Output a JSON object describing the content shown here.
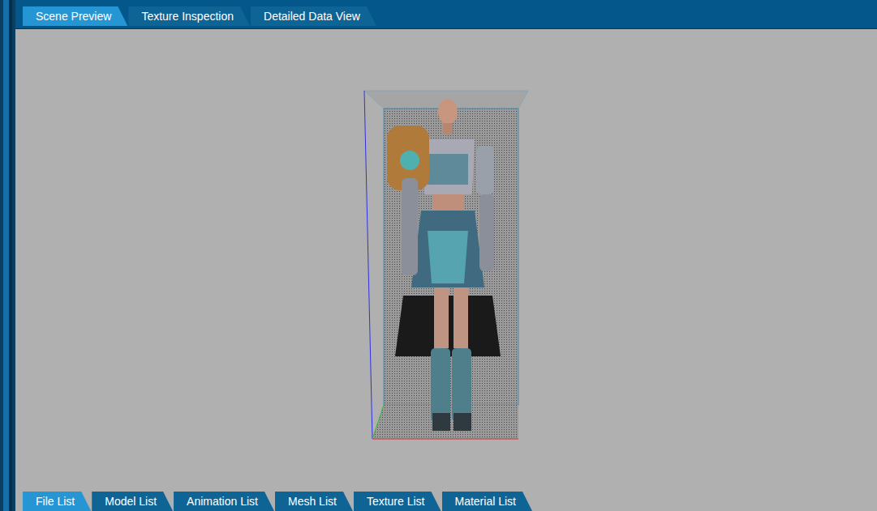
{
  "top_tabs": [
    {
      "label": "Scene Preview",
      "selected": true
    },
    {
      "label": "Texture Inspection",
      "selected": false
    },
    {
      "label": "Detailed Data View",
      "selected": false
    }
  ],
  "bottom_tabs": [
    {
      "label": "File List",
      "selected": true
    },
    {
      "label": "Model List",
      "selected": false
    },
    {
      "label": "Animation List",
      "selected": false
    },
    {
      "label": "Mesh List",
      "selected": false
    },
    {
      "label": "Texture List",
      "selected": false
    },
    {
      "label": "Material List",
      "selected": false
    }
  ]
}
